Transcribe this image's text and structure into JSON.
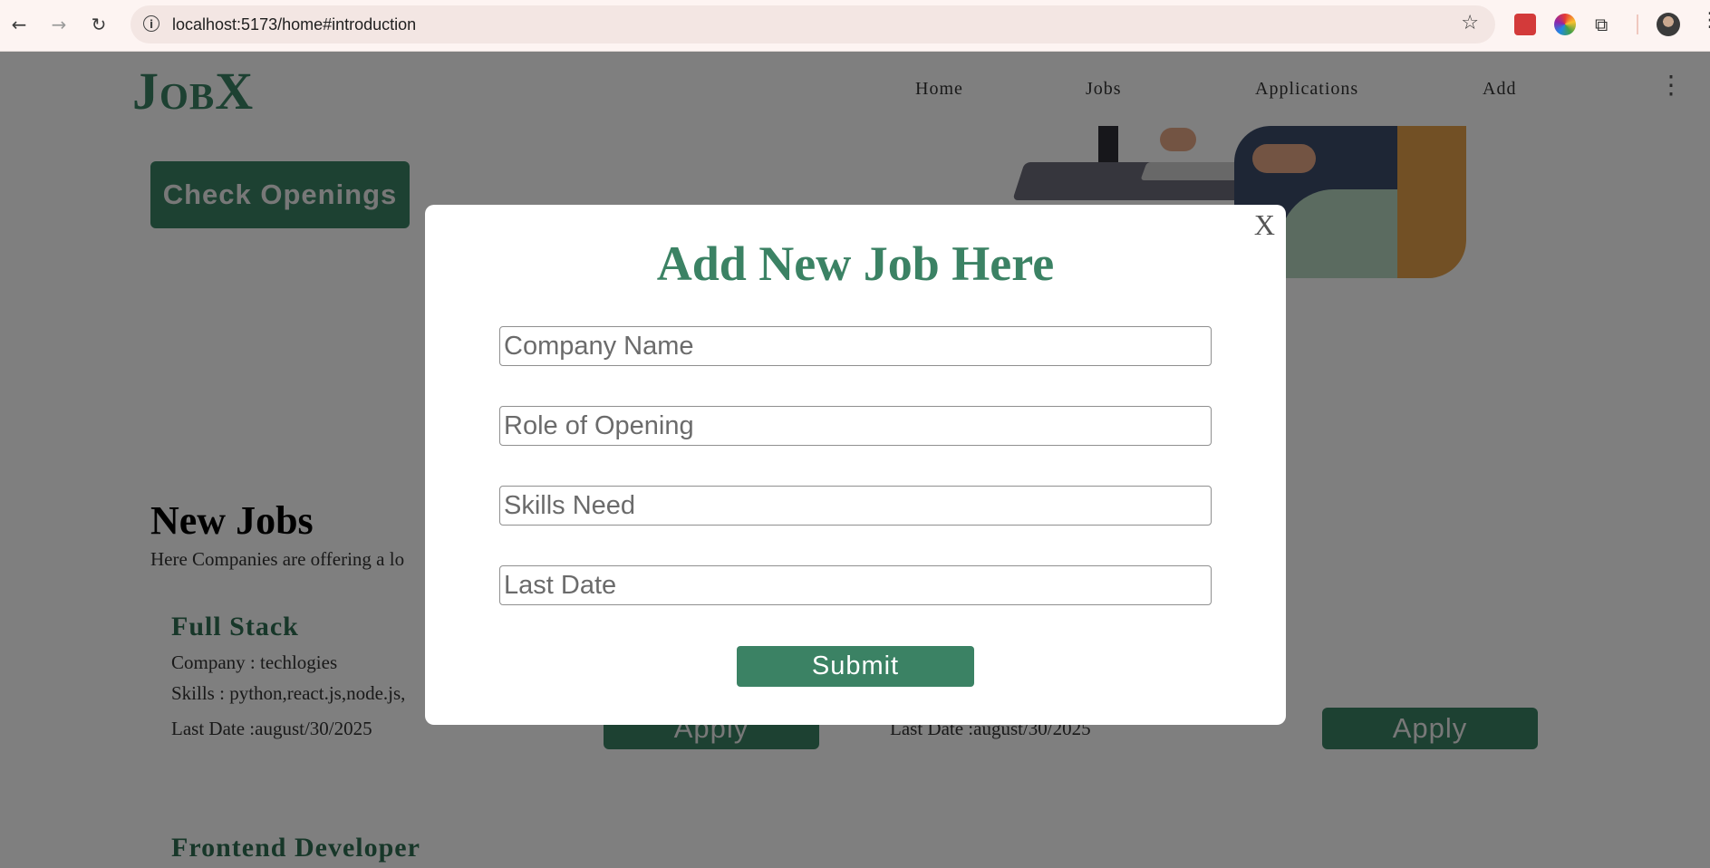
{
  "browser": {
    "url": "localhost:5173/home#introduction",
    "info_icon": "i",
    "star_icon": "☆",
    "menu_icon": "⋮"
  },
  "site": {
    "logo": "JobX",
    "nav": [
      "Home",
      "Jobs",
      "Applications",
      "Add"
    ],
    "menu_icon": "⋮",
    "check_openings": "Check Openings"
  },
  "new_jobs": {
    "title": "New Jobs",
    "subtitle": "Here Companies are offering a lo",
    "jobs": [
      {
        "title": "Full Stack",
        "company": "Company : techlogies",
        "skills": "Skills : python,react.js,node.js,",
        "last_date": "Last Date :august/30/2025",
        "apply": "Apply"
      },
      {
        "last_date": "Last Date :august/30/2025",
        "apply": "Apply"
      },
      {
        "title": "Frontend Developer"
      }
    ]
  },
  "modal": {
    "close": "X",
    "title": "Add New Job Here",
    "fields": {
      "company_name": "Company Name",
      "role": "Role of Opening",
      "skills": "Skills Need",
      "last_date": "Last Date"
    },
    "submit": "Submit"
  },
  "colors": {
    "accent": "#3b8264",
    "overlay": "rgba(0,0,0,0.5)"
  }
}
